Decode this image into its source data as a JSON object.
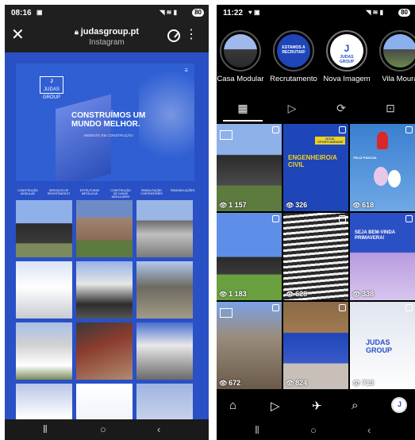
{
  "left_screen": {
    "status": {
      "time": "08:16",
      "battery": "80"
    },
    "browser": {
      "url": "judasgroup.pt",
      "site_name": "Instagram"
    },
    "hero": {
      "headline": "CONSTRUÍMOS UM MUNDO MELHOR.",
      "sub": "WEBSITE EM CONSTRUÇÃO",
      "logo_text": "JUDAS GROUP"
    },
    "site_nav": [
      "CONSTRUÇÃO MODULAR",
      "SERVIÇOS DE REVESTIMENTO",
      "ESTRUTURAS METÁLICAS",
      "CONSTRUÇÃO DE CASAS MODULARES",
      "REABILITAÇÃO CONTENTORES",
      "REMODELAÇÕES"
    ]
  },
  "right_screen": {
    "status": {
      "time": "11:22",
      "battery": "80"
    },
    "highlights": [
      {
        "label": "Casa Modular"
      },
      {
        "label": "Recrutamento"
      },
      {
        "label": "Nova Imagem"
      },
      {
        "label": "Vila Moura"
      }
    ],
    "posts": [
      {
        "views": "1 157"
      },
      {
        "views": "326",
        "caption": "ENGENHEIRO/A CIVIL"
      },
      {
        "views": "618",
        "caption": "FELIZ PÁSCOA"
      },
      {
        "views": "1 183"
      },
      {
        "views": "628"
      },
      {
        "views": "338",
        "caption": "SEJA BEM-VINDA PRIMAVERA!"
      },
      {
        "views": "672"
      },
      {
        "views": "824"
      },
      {
        "views": "713",
        "caption": "JUDAS GROUP"
      }
    ],
    "highlight_text": {
      "recruit": "ESTAMOS A RECRUTAR!",
      "brand": "JUDAS GROUP"
    },
    "post2_banner": "NOVA OPORTUNIDADE"
  },
  "colors": {
    "brand_blue": "#2a50c5",
    "ig_bg": "#000000"
  }
}
